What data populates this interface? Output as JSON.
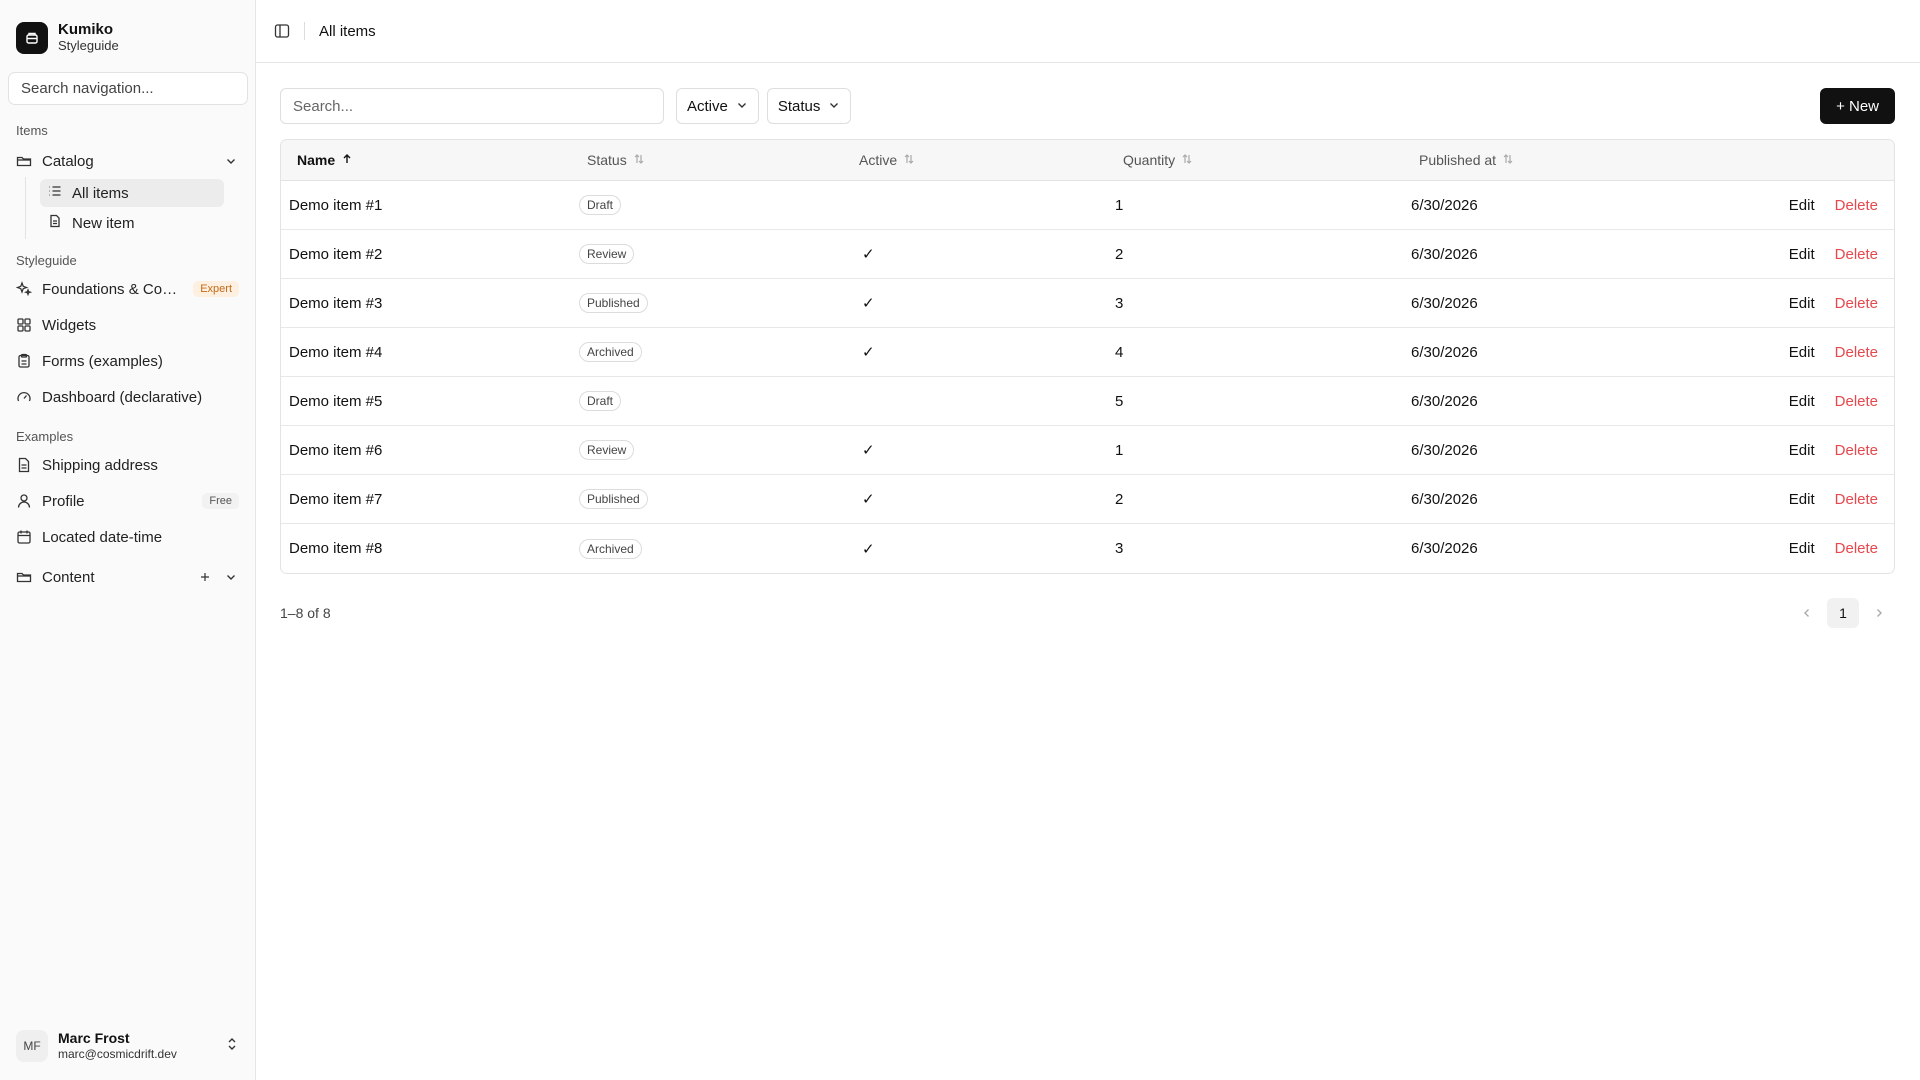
{
  "brand": {
    "name": "Kumiko",
    "subtitle": "Styleguide",
    "logo_icon": "box-icon"
  },
  "nav_search": {
    "placeholder": "Search navigation..."
  },
  "sidebar": {
    "group_items": "Items",
    "catalog": {
      "label": "Catalog",
      "icon": "folder-icon",
      "children": [
        {
          "label": "All items",
          "icon": "list-icon",
          "active": true
        },
        {
          "label": "New item",
          "icon": "file-icon"
        }
      ]
    },
    "group_styleguide": "Styleguide",
    "styleguide_items": [
      {
        "label": "Foundations & Com...",
        "icon": "sparkles-icon",
        "badge": "Expert"
      },
      {
        "label": "Widgets",
        "icon": "grid-icon"
      },
      {
        "label": "Forms (examples)",
        "icon": "clipboard-icon"
      },
      {
        "label": "Dashboard (declarative)",
        "icon": "gauge-icon"
      }
    ],
    "group_examples": "Examples",
    "example_items": [
      {
        "label": "Shipping address",
        "icon": "file-icon"
      },
      {
        "label": "Profile",
        "icon": "user-icon",
        "badge": "Free"
      },
      {
        "label": "Located date-time",
        "icon": "calendar-icon"
      }
    ],
    "content": {
      "label": "Content",
      "icon": "folder-icon"
    }
  },
  "user": {
    "initials": "MF",
    "name": "Marc Frost",
    "email": "marc@cosmicdrift.dev"
  },
  "topbar": {
    "breadcrumb": "All items"
  },
  "toolbar": {
    "search_placeholder": "Search...",
    "filter_active": "Active",
    "filter_status": "Status",
    "new_label": "+ New"
  },
  "table": {
    "columns": [
      "Name",
      "Status",
      "Active",
      "Quantity",
      "Published at"
    ],
    "sorted_column": "Name",
    "rows": [
      {
        "name": "Demo item #1",
        "status": "Draft",
        "active": "",
        "quantity": "1",
        "published": "6/30/2026"
      },
      {
        "name": "Demo item #2",
        "status": "Review",
        "active": "✓",
        "quantity": "2",
        "published": "6/30/2026"
      },
      {
        "name": "Demo item #3",
        "status": "Published",
        "active": "✓",
        "quantity": "3",
        "published": "6/30/2026"
      },
      {
        "name": "Demo item #4",
        "status": "Archived",
        "active": "✓",
        "quantity": "4",
        "published": "6/30/2026"
      },
      {
        "name": "Demo item #5",
        "status": "Draft",
        "active": "",
        "quantity": "5",
        "published": "6/30/2026"
      },
      {
        "name": "Demo item #6",
        "status": "Review",
        "active": "✓",
        "quantity": "1",
        "published": "6/30/2026"
      },
      {
        "name": "Demo item #7",
        "status": "Published",
        "active": "✓",
        "quantity": "2",
        "published": "6/30/2026"
      },
      {
        "name": "Demo item #8",
        "status": "Archived",
        "active": "✓",
        "quantity": "3",
        "published": "6/30/2026"
      }
    ],
    "edit_label": "Edit",
    "delete_label": "Delete"
  },
  "pager": {
    "info": "1–8 of 8",
    "current_page": "1"
  },
  "colors": {
    "accent": "#111111",
    "danger": "#e5484d",
    "badge_expert_bg": "#fdf0e0",
    "badge_expert_fg": "#c26a18"
  }
}
